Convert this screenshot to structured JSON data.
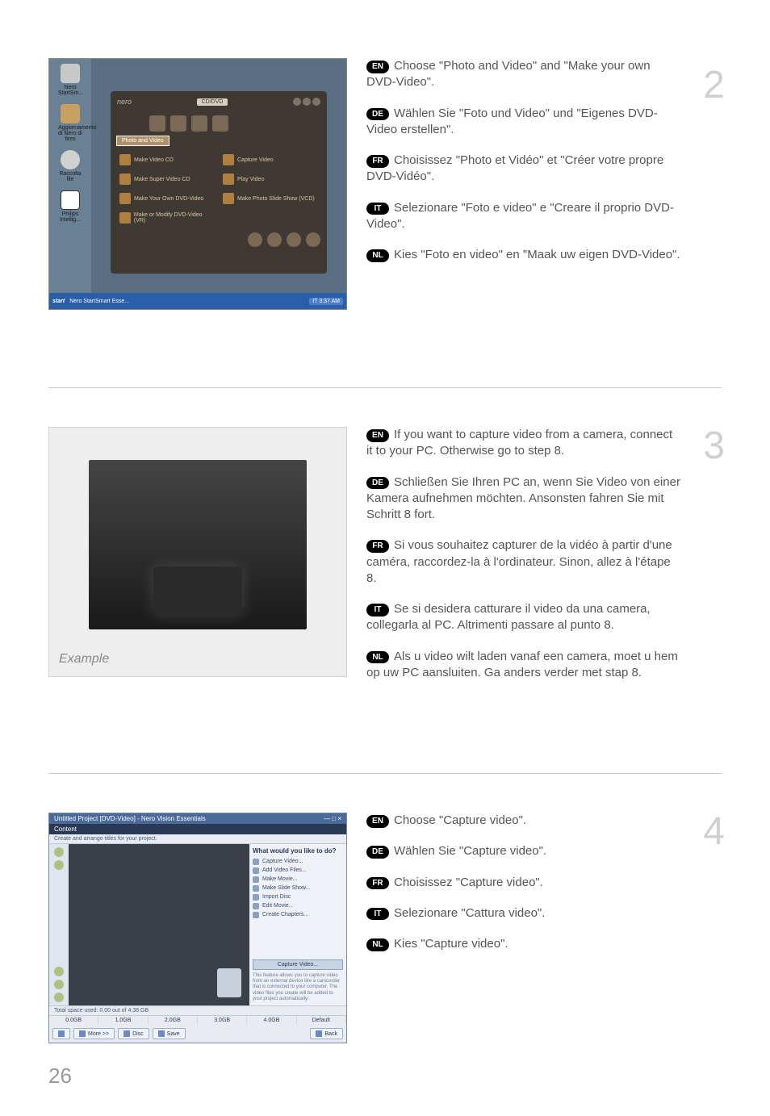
{
  "page_number": "26",
  "steps": [
    {
      "number": "2",
      "blocks": [
        {
          "lang": "EN",
          "text": "Choose \"Photo and Video\" and \"Make your own DVD-Video\"."
        },
        {
          "lang": "DE",
          "text": "Wählen Sie \"Foto und Video\" und \"Eigenes DVD-Video erstellen\"."
        },
        {
          "lang": "FR",
          "text": "Choisissez \"Photo et Vidéo\" et \"Créer votre propre DVD-Vidéo\"."
        },
        {
          "lang": "IT",
          "text": "Selezionare \"Foto e video\" e \"Creare il proprio DVD-Video\"."
        },
        {
          "lang": "NL",
          "text": "Kies \"Foto en video\" en \"Maak uw eigen DVD-Video\"."
        }
      ],
      "screenshot": {
        "desktop_icons": [
          {
            "label": "Nero StartSm..."
          },
          {
            "label": "Aggiornamento di Nero di fires"
          },
          {
            "label": "Raccolta file"
          },
          {
            "label": "Philips Intellig..."
          }
        ],
        "window": {
          "logo": "nero",
          "drive_label": "CD/DVD",
          "tabs": [
            "Photo and Video"
          ],
          "active_tab": "Photo and Video",
          "items": [
            "Make Video CD",
            "Capture Video",
            "Make Super Video CD",
            "Play Video",
            "Make Your Own DVD-Video",
            "Make Photo Slide Show (VCD)",
            "Make or Modify DVD-Video (VR)"
          ]
        },
        "taskbar": {
          "start": "start",
          "task": "Nero StartSmart Esse...",
          "tray": "IT 3:37 AM"
        }
      }
    },
    {
      "number": "3",
      "blocks": [
        {
          "lang": "EN",
          "text": "If you want to capture video from a camera, connect it to your PC. Otherwise go to step 8."
        },
        {
          "lang": "DE",
          "text": "Schließen Sie Ihren PC an, wenn Sie Video von einer Kamera aufnehmen möchten. Ansonsten fahren Sie mit Schritt 8 fort."
        },
        {
          "lang": "FR",
          "text": "Si vous souhaitez capturer de la vidéo à partir d'une caméra, raccordez-la à l'ordinateur. Sinon, allez à l'étape 8."
        },
        {
          "lang": "IT",
          "text": "Se si desidera catturare il video da una camera, collegarla al PC. Altrimenti passare al punto 8."
        },
        {
          "lang": "NL",
          "text": "Als u video wilt laden vanaf een camera, moet u hem op uw PC aansluiten. Ga anders verder met stap 8."
        }
      ],
      "example_label": "Example"
    },
    {
      "number": "4",
      "blocks": [
        {
          "lang": "EN",
          "text": "Choose \"Capture video\"."
        },
        {
          "lang": "DE",
          "text": "Wählen Sie \"Capture video\"."
        },
        {
          "lang": "FR",
          "text": "Choisissez \"Capture video\"."
        },
        {
          "lang": "IT",
          "text": "Selezionare \"Cattura video\"."
        },
        {
          "lang": "NL",
          "text": "Kies \"Capture video\"."
        }
      ],
      "screenshot": {
        "title": "Untitled Project [DVD-Video] - Nero Vision Essentials",
        "section": "Content",
        "hint": "Create and arrange titles for your project.",
        "right_header": "What would you like to do?",
        "right_options": [
          "Capture Video...",
          "Add Video Files...",
          "Make Movie...",
          "Make Slide Show...",
          "Import Disc",
          "Edit Movie...",
          "Create Chapters..."
        ],
        "capture_button": "Capture Video...",
        "capture_desc": "This feature allows you to capture video from an external device like a camcorder that is connected to your computer. The video files you create will be added to your project automatically.",
        "space_label": "Total space used: 0.00 out of 4.38 GB",
        "timeline_marks": [
          "0.0GB",
          "1.0GB",
          "2.0GB",
          "3.0GB",
          "4.0GB"
        ],
        "toolbar": {
          "more": "More >>",
          "disc": "Disc",
          "save": "Save",
          "default": "Default",
          "back": "Back"
        }
      }
    }
  ]
}
